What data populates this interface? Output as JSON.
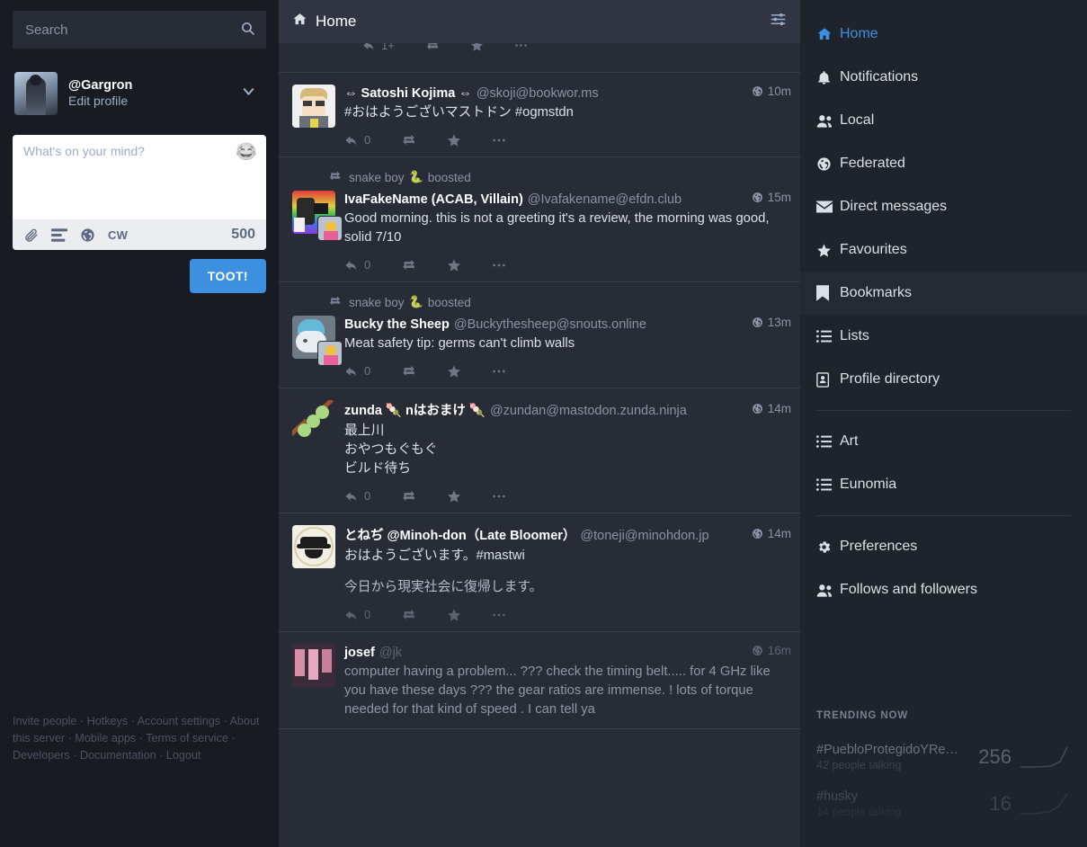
{
  "search": {
    "placeholder": "Search",
    "icon": "search-icon"
  },
  "account": {
    "handle": "@Gargron",
    "edit_label": "Edit profile"
  },
  "compose": {
    "placeholder": "What's on your mind?",
    "cw_label": "CW",
    "char_count": "500",
    "toot_label": "TOOT!",
    "icons": [
      "paperclip-icon",
      "poll-icon",
      "globe-icon"
    ]
  },
  "drawer_footer": [
    "Invite people",
    "Hotkeys",
    "Account settings",
    "About this server",
    "Mobile apps",
    "Terms of service",
    "Developers",
    "Documentation",
    "Logout"
  ],
  "column": {
    "title": "Home",
    "icon": "home-icon",
    "settings_icon": "sliders-icon"
  },
  "statuses": [
    {
      "display_name": "⇔ Satoshi Kojima ⇔",
      "handle": "@skoji@bookwor.ms",
      "time": "10m",
      "content": "#おはようございマストドン #ogmstdn",
      "reply_count": "0"
    },
    {
      "boosted_by": "snake boy",
      "boost_emoji": "🐍",
      "boost_label": "boosted",
      "display_name": "IvaFakeName (ACAB, Villain)",
      "handle": "@Ivafakename@efdn.club",
      "time": "15m",
      "content": "Good morning. this is not a greeting it's a review, the morning was good, solid 7/10",
      "reply_count": "0"
    },
    {
      "boosted_by": "snake boy",
      "boost_emoji": "🐍",
      "boost_label": "boosted",
      "display_name": "Bucky the Sheep",
      "handle": "@Buckythesheep@snouts.online",
      "time": "13m",
      "content": "Meat safety tip: germs can't climb walls",
      "reply_count": "0"
    },
    {
      "display_name": "zunda 🍡 nはおまけ 🍡",
      "handle": "@zundan@mastodon.zunda.ninja",
      "time": "14m",
      "content": "最上川\nおやつもぐもぐ\nビルド待ち",
      "reply_count": "0"
    },
    {
      "display_name": "とねぢ @Minoh-don（Late Bloomer）",
      "handle": "@toneji@minohdon.jp",
      "time": "14m",
      "content": "おはようございます。#mastwi",
      "content2": "今日から現実社会に復帰します。",
      "reply_count": "0"
    },
    {
      "display_name": "josef",
      "handle": "@jk",
      "time": "16m",
      "content": "computer having a problem... ??? check the timing belt..... for 4 GHz like you have these days ??? the gear ratios are immense. ! lots of torque needed for that kind of speed . I can tell ya",
      "reply_count": "0"
    }
  ],
  "nav": {
    "primary": [
      {
        "label": "Home",
        "icon": "home-icon",
        "active": true
      },
      {
        "label": "Notifications",
        "icon": "bell-icon",
        "active": false
      },
      {
        "label": "Local",
        "icon": "users-icon",
        "active": false
      },
      {
        "label": "Federated",
        "icon": "globe-icon",
        "active": false
      },
      {
        "label": "Direct messages",
        "icon": "envelope-icon",
        "active": false
      },
      {
        "label": "Favourites",
        "icon": "star-icon",
        "active": false
      },
      {
        "label": "Bookmarks",
        "icon": "bookmark-icon",
        "active": false,
        "hovered": true
      },
      {
        "label": "Lists",
        "icon": "list-icon",
        "active": false
      },
      {
        "label": "Profile directory",
        "icon": "address-book-icon",
        "active": false
      }
    ],
    "lists": [
      {
        "label": "Art",
        "icon": "list-icon"
      },
      {
        "label": "Eunomia",
        "icon": "list-icon"
      }
    ],
    "settings": [
      {
        "label": "Preferences",
        "icon": "gear-icon"
      },
      {
        "label": "Follows and followers",
        "icon": "users-icon"
      }
    ]
  },
  "trends": {
    "title": "TRENDING NOW",
    "items": [
      {
        "tag": "#PuebloProtegidoYRe…",
        "sub": "42 people talking",
        "count": "256"
      },
      {
        "tag": "#husky",
        "sub": "14 people talking",
        "count": "16"
      }
    ]
  },
  "colors": {
    "accent": "#3c90df",
    "panel": "#282c37",
    "nav_bg": "#1f232b",
    "page_bg": "#191b22"
  }
}
